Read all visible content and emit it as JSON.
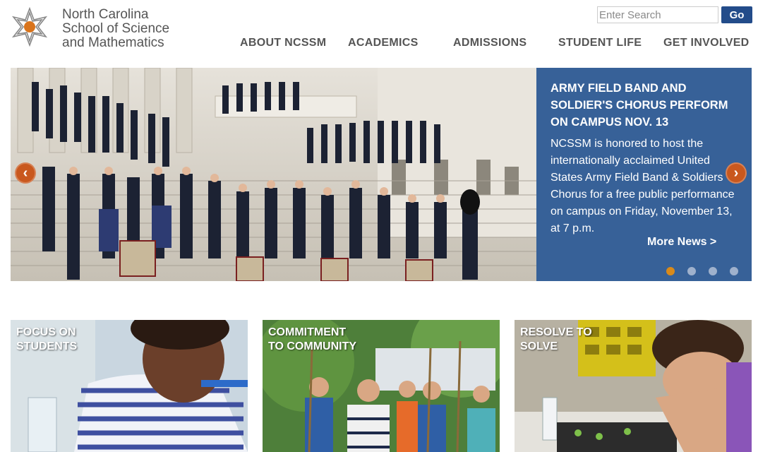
{
  "logo": {
    "line1": "North Carolina",
    "line2": "School of Science",
    "line3": "and Mathematics"
  },
  "search": {
    "placeholder": "Enter Search",
    "go_label": "Go"
  },
  "nav": {
    "items": [
      {
        "label": "ABOUT NCSSM"
      },
      {
        "label": "ACADEMICS"
      },
      {
        "label": "ADMISSIONS"
      },
      {
        "label": "STUDENT LIFE"
      },
      {
        "label": "GET INVOLVED"
      }
    ]
  },
  "hero": {
    "headline": "ARMY FIELD BAND AND SOLDIER'S CHORUS PERFORM ON CAMPUS NOV. 13",
    "body": "NCSSM is honored to host the internationally acclaimed United States Army Field Band & Soldiers Chorus for a free public performance on campus on Friday, November 13, at 7 p.m.",
    "more": "More News >",
    "slides_total": 4,
    "slide_active": 1,
    "prev_icon": "chevron-left-icon",
    "next_icon": "chevron-right-icon"
  },
  "tiles": [
    {
      "line1": "FOCUS ON",
      "line2": "STUDENTS"
    },
    {
      "line1": "COMMITMENT",
      "line2": "TO COMMUNITY"
    },
    {
      "line1": "RESOLVE TO",
      "line2": "SOLVE"
    }
  ],
  "colors": {
    "brand_blue": "#376198",
    "accent_orange": "#d98a1a",
    "go_button": "#234c8a"
  }
}
